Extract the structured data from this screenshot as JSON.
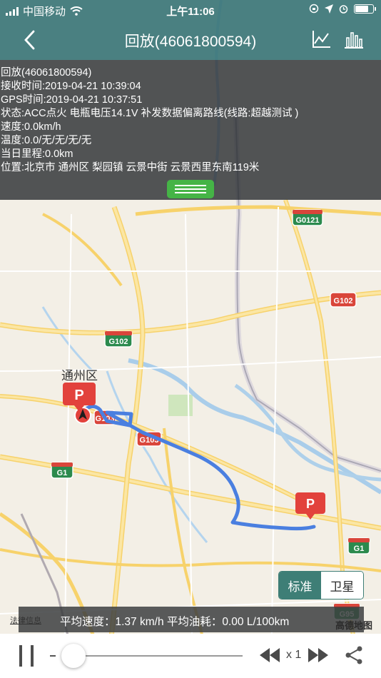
{
  "status_bar": {
    "carrier": "中国移动",
    "time": "上午11:06"
  },
  "nav": {
    "title": "回放(46061800594)",
    "icons": [
      "back-chevron-icon",
      "line-chart-icon",
      "bar-chart-icon"
    ]
  },
  "info_panel": {
    "lines": [
      "回放(46061800594)",
      "接收时间:2019-04-21 10:39:04",
      "GPS时间:2019-04-21 10:37:51",
      "状态:ACC点火 电瓶电压14.1V 补发数据偏离路线(线路:超越测试 )",
      "速度:0.0km/h",
      "温度:0.0/无/无/无/无",
      "当日里程:0.0km",
      "位置:北京市 通州区 梨园镇 云景中街 云景西里东南119米"
    ],
    "toggle_color": "#45b446"
  },
  "map": {
    "district_label": "通州区",
    "road_shields": [
      "G0121",
      "G102",
      "G102",
      "G103",
      "G103",
      "G1",
      "G1",
      "G95"
    ],
    "parking_marker_label": "P",
    "route_color": "#4a7fe0",
    "marker_color": "#e2423c"
  },
  "map_type": {
    "standard": "标准",
    "satellite": "卫星",
    "selected": "标准",
    "accent": "#3e7e76"
  },
  "stats": {
    "text": "平均速度：1.37 km/h   平均油耗：0.00 L/100km"
  },
  "legal_link": "法律信息",
  "brand": "高德地图",
  "playback": {
    "speed_label": "x 1",
    "progress": 0.06
  }
}
